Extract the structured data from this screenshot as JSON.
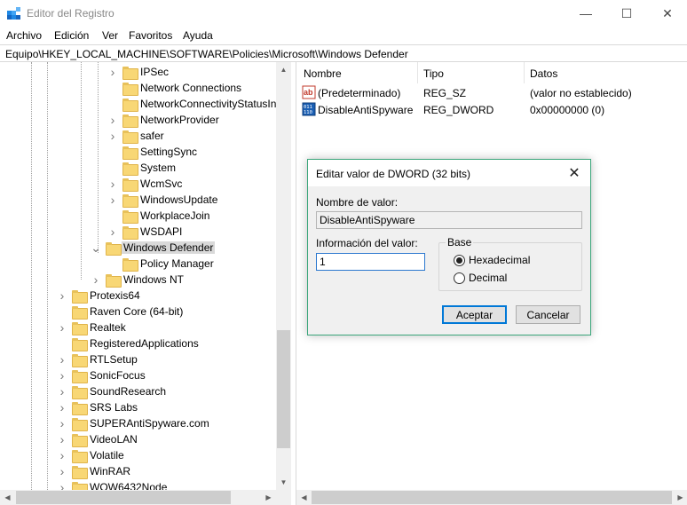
{
  "window": {
    "title": "Editor del Registro",
    "minimize_glyph": "—",
    "maximize_glyph": "☐",
    "close_glyph": "✕"
  },
  "menu": [
    "Archivo",
    "Edición",
    "Ver",
    "Favoritos",
    "Ayuda"
  ],
  "address": "Equipo\\HKEY_LOCAL_MACHINE\\SOFTWARE\\Policies\\Microsoft\\Windows Defender",
  "tree": {
    "items": [
      {
        "label": "IPSec",
        "level": 3,
        "expander": ">"
      },
      {
        "label": "Network Connections",
        "level": 3,
        "expander": ""
      },
      {
        "label": "NetworkConnectivityStatusIn",
        "level": 3,
        "expander": ""
      },
      {
        "label": "NetworkProvider",
        "level": 3,
        "expander": ">"
      },
      {
        "label": "safer",
        "level": 3,
        "expander": ">"
      },
      {
        "label": "SettingSync",
        "level": 3,
        "expander": ""
      },
      {
        "label": "System",
        "level": 3,
        "expander": ""
      },
      {
        "label": "WcmSvc",
        "level": 3,
        "expander": ">"
      },
      {
        "label": "WindowsUpdate",
        "level": 3,
        "expander": ">"
      },
      {
        "label": "WorkplaceJoin",
        "level": 3,
        "expander": ""
      },
      {
        "label": "WSDAPI",
        "level": 3,
        "expander": ">"
      },
      {
        "label": "Windows Defender",
        "level": 2,
        "expander": "v",
        "selected": true
      },
      {
        "label": "Policy Manager",
        "level": 3,
        "expander": ""
      },
      {
        "label": "Windows NT",
        "level": 2,
        "expander": ">"
      },
      {
        "label": "Protexis64",
        "level": 1,
        "expander": ">"
      },
      {
        "label": "Raven Core (64-bit)",
        "level": 1,
        "expander": ""
      },
      {
        "label": "Realtek",
        "level": 1,
        "expander": ">"
      },
      {
        "label": "RegisteredApplications",
        "level": 1,
        "expander": ""
      },
      {
        "label": "RTLSetup",
        "level": 1,
        "expander": ">"
      },
      {
        "label": "SonicFocus",
        "level": 1,
        "expander": ">"
      },
      {
        "label": "SoundResearch",
        "level": 1,
        "expander": ">"
      },
      {
        "label": "SRS Labs",
        "level": 1,
        "expander": ">"
      },
      {
        "label": "SUPERAntiSpyware.com",
        "level": 1,
        "expander": ">"
      },
      {
        "label": "VideoLAN",
        "level": 1,
        "expander": ">"
      },
      {
        "label": "Volatile",
        "level": 1,
        "expander": ">"
      },
      {
        "label": "WinRAR",
        "level": 1,
        "expander": ">"
      },
      {
        "label": "WOW6432Node",
        "level": 1,
        "expander": ">"
      }
    ]
  },
  "list": {
    "columns": [
      "Nombre",
      "Tipo",
      "Datos"
    ],
    "rows": [
      {
        "name": "(Predeterminado)",
        "type": "REG_SZ",
        "data": "(valor no establecido)",
        "icon": "string-value-icon"
      },
      {
        "name": "DisableAntiSpyware",
        "type": "REG_DWORD",
        "data": "0x00000000 (0)",
        "icon": "binary-value-icon"
      }
    ]
  },
  "dialog": {
    "title": "Editar valor de DWORD (32 bits)",
    "close_glyph": "✕",
    "value_name_label": "Nombre de valor:",
    "value_name": "DisableAntiSpyware",
    "value_data_label": "Información del valor:",
    "value_data": "1",
    "base_label": "Base",
    "base_options": [
      {
        "label": "Hexadecimal",
        "selected": true
      },
      {
        "label": "Decimal",
        "selected": false
      }
    ],
    "ok_label": "Aceptar",
    "cancel_label": "Cancelar"
  },
  "colors": {
    "folder": "#f8d775",
    "dialog_border": "#3aa57a",
    "default_button_border": "#0078d7"
  }
}
